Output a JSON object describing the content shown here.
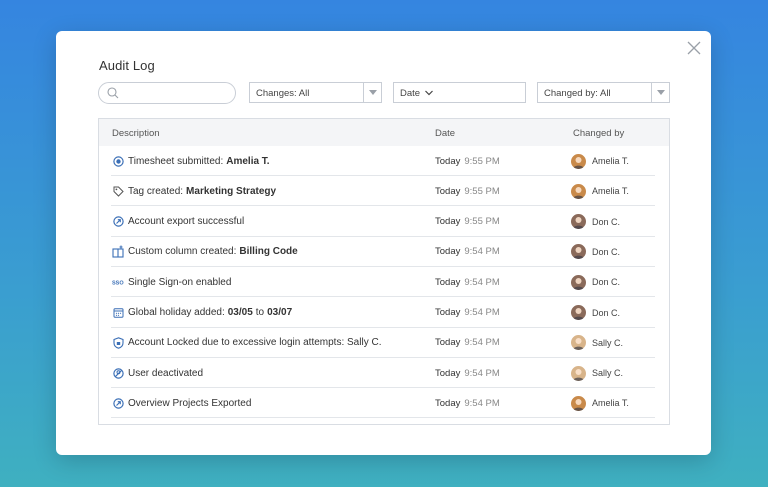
{
  "dialog": {
    "title": "Audit Log",
    "close_icon": "close-icon"
  },
  "filters": {
    "search_value": "",
    "search_placeholder": "",
    "changes_label": "Changes: All",
    "date_label": "Date",
    "changed_by_label": "Changed by: All"
  },
  "table": {
    "headers": {
      "description": "Description",
      "date": "Date",
      "changed_by": "Changed by"
    },
    "rows": [
      {
        "icon": "timesheet-icon",
        "text": "Timesheet submitted:",
        "bold": "Amelia T.",
        "extra": "",
        "day": "Today",
        "time": "9:55 PM",
        "user": "Amelia T.",
        "avatar_color": "#c98a4a"
      },
      {
        "icon": "tag-icon",
        "text": "Tag created:",
        "bold": "Marketing Strategy",
        "extra": "",
        "day": "Today",
        "time": "9:55 PM",
        "user": "Amelia T.",
        "avatar_color": "#c98a4a"
      },
      {
        "icon": "export-icon",
        "text": "Account export successful",
        "bold": "",
        "extra": "",
        "day": "Today",
        "time": "9:55 PM",
        "user": "Don C.",
        "avatar_color": "#8a6a5a"
      },
      {
        "icon": "custom-column-icon",
        "text": "Custom column created:",
        "bold": "Billing Code",
        "extra": "",
        "day": "Today",
        "time": "9:54 PM",
        "user": "Don C.",
        "avatar_color": "#8a6a5a"
      },
      {
        "icon": "sso-icon",
        "text": "Single Sign-on enabled",
        "bold": "",
        "extra": "",
        "day": "Today",
        "time": "9:54 PM",
        "user": "Don C.",
        "avatar_color": "#8a6a5a"
      },
      {
        "icon": "calendar-icon",
        "text": "Global holiday added:",
        "bold": "03/05",
        "extra": "to",
        "bold2": "03/07",
        "day": "Today",
        "time": "9:54 PM",
        "user": "Don C.",
        "avatar_color": "#8a6a5a"
      },
      {
        "icon": "shield-icon",
        "text": "Account Locked due to excessive login attempts: Sally C.",
        "bold": "",
        "extra": "",
        "day": "Today",
        "time": "9:54 PM",
        "user": "Sally C.",
        "avatar_color": "#d8b48a"
      },
      {
        "icon": "user-deactivated-icon",
        "text": "User deactivated",
        "bold": "",
        "extra": "",
        "day": "Today",
        "time": "9:54 PM",
        "user": "Sally C.",
        "avatar_color": "#d8b48a"
      },
      {
        "icon": "export-icon",
        "text": "Overview Projects Exported",
        "bold": "",
        "extra": "",
        "day": "Today",
        "time": "9:54 PM",
        "user": "Amelia T.",
        "avatar_color": "#c98a4a"
      }
    ]
  },
  "colors": {
    "icon_blue": "#3b6fb6",
    "border": "#c9ced6"
  }
}
